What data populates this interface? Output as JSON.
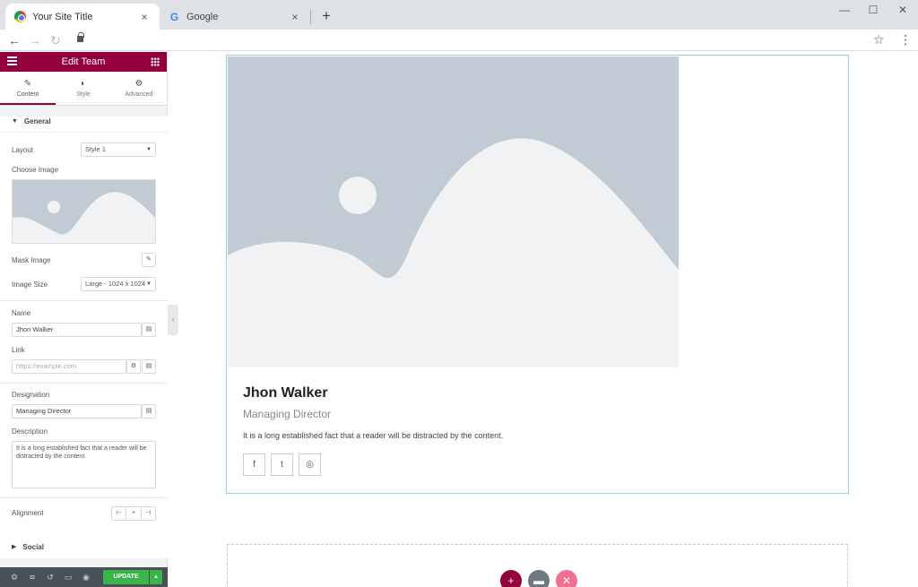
{
  "browser": {
    "tabs": [
      {
        "title": "Your Site Title",
        "active": true
      },
      {
        "title": "Google",
        "active": false
      }
    ],
    "icons": {
      "close": "×",
      "new_tab": "+",
      "minimize": "—",
      "maximize": "☐",
      "window_close": "✕",
      "back": "←",
      "forward": "→",
      "reload": "↻",
      "star": "☆",
      "menu": "⋮"
    }
  },
  "sidebar": {
    "title": "Edit Team",
    "tabs": [
      {
        "label": "Content",
        "icon": "✎"
      },
      {
        "label": "Style",
        "icon": "◐"
      },
      {
        "label": "Advanced",
        "icon": "⚙"
      }
    ],
    "general": {
      "title": "General",
      "layout_label": "Layout",
      "layout_value": "Style 1",
      "choose_image_label": "Choose Image",
      "mask_image_label": "Mask Image",
      "image_size_label": "Image Size",
      "image_size_value": "Large - 1024 x 1024",
      "name_label": "Name",
      "name_value": "Jhon Walker",
      "link_label": "Link",
      "link_placeholder": "https://example.com",
      "designation_label": "Designation",
      "designation_value": "Managing Director",
      "description_label": "Description",
      "description_value": "It is a long established fact that a reader will be distracted by the content.",
      "alignment_label": "Alignment"
    },
    "social_title": "Social",
    "footer": {
      "update_label": "UPDATE"
    }
  },
  "card": {
    "name": "Jhon Walker",
    "designation": "Managing Director",
    "description": "It is a long established fact that a reader will be distracted by the content.",
    "social_icons": [
      "f",
      "t",
      "◎"
    ]
  },
  "colors": {
    "accent": "#93003c",
    "update": "#39b54a",
    "selection": "#8ad4ee",
    "placeholder": "#c2cad3"
  }
}
